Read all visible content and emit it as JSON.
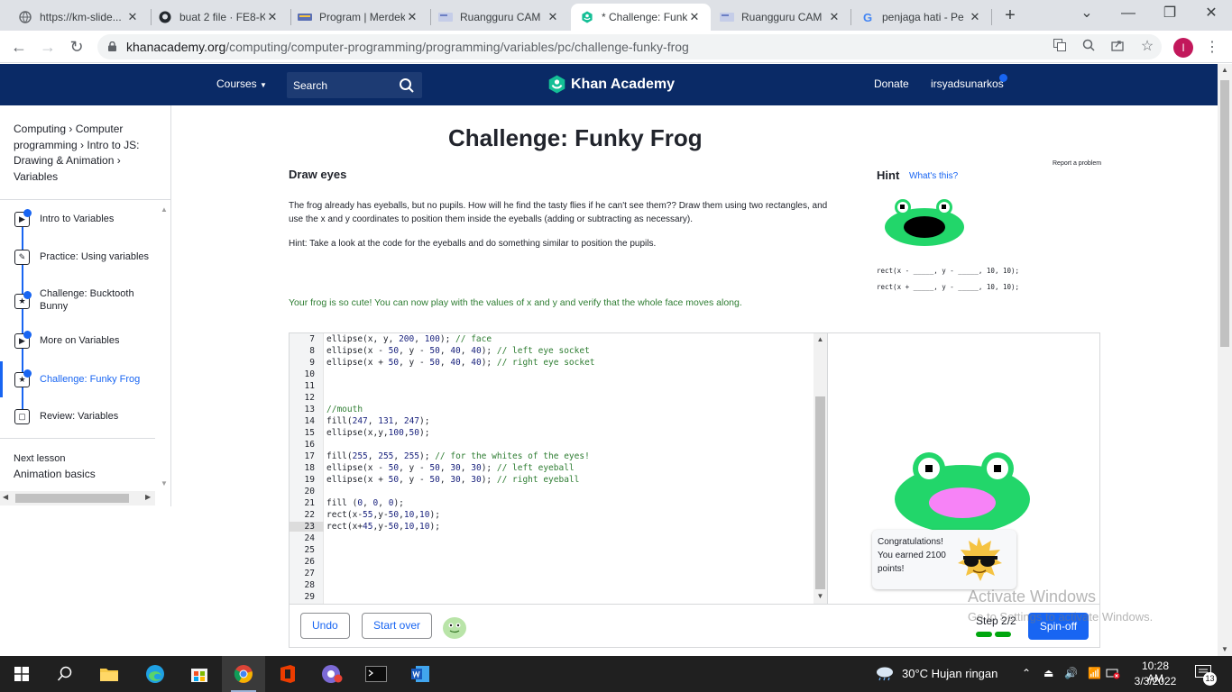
{
  "browser": {
    "tabs": [
      {
        "title": "https://km-slide...",
        "icon": "globe-icon"
      },
      {
        "title": "buat 2 file · FE8-K",
        "icon": "github-icon"
      },
      {
        "title": "Program | Merdek",
        "icon": "kemdikbud-icon"
      },
      {
        "title": "Ruangguru CAM",
        "icon": "ruangguru-icon"
      },
      {
        "title": "* Challenge: Funk",
        "icon": "khan-academy-icon",
        "active": true
      },
      {
        "title": "Ruangguru CAM",
        "icon": "ruangguru-icon"
      },
      {
        "title": "penjaga hati - Pe",
        "icon": "google-icon"
      }
    ],
    "url_domain": "khanacademy.org",
    "url_path": "/computing/computer-programming/programming/variables/pc/challenge-funky-frog",
    "profile_initial": "I"
  },
  "header": {
    "courses_label": "Courses",
    "search_placeholder": "Search",
    "logo_text": "Khan Academy",
    "donate_label": "Donate",
    "username": "irsyadsunarkos",
    "bg_color": "#0a2a66"
  },
  "sidebar": {
    "breadcrumb": [
      {
        "label": "Computing"
      },
      {
        "label": "Computer programming"
      },
      {
        "label": "Intro to JS: Drawing & Animation"
      },
      {
        "label": "Variables"
      }
    ],
    "items": [
      {
        "label": "Intro to Variables",
        "icon": "video-icon",
        "completed": true
      },
      {
        "label": "Practice: Using variables",
        "icon": "pencil-icon",
        "completed": false
      },
      {
        "label": "Challenge: Bucktooth Bunny",
        "icon": "star-icon",
        "completed": true
      },
      {
        "label": "More on Variables",
        "icon": "video-icon",
        "completed": true
      },
      {
        "label": "Challenge: Funky Frog",
        "icon": "star-icon",
        "completed": true,
        "active": true
      },
      {
        "label": "Review: Variables",
        "icon": "article-icon",
        "completed": false
      }
    ],
    "next_lesson_label": "Next lesson",
    "next_lesson_title": "Animation basics"
  },
  "main": {
    "title": "Challenge: Funky Frog",
    "step_title": "Draw eyes",
    "report_problem": "Report a problem",
    "instructions": "The frog already has eyeballs, but no pupils. How will he find the tasty flies if he can't see them?? Draw them using two rectangles, and use the x and y coordinates to position them inside the eyeballs (adding or subtracting as necessary).",
    "hint_text": "Hint: Take a look at the code for the eyeballs and do something similar to position the pupils.",
    "success_message": "Your frog is so cute! You can now play with the values of x and y and verify that the whole face moves along.",
    "hint_heading": "Hint",
    "whats_this": "What's this?",
    "hint_code": [
      "rect(x - _____, y - _____, 10, 10);",
      "rect(x + _____, y - _____, 10, 10);"
    ]
  },
  "editor": {
    "lines": [
      {
        "n": "7",
        "code": "ellipse(x, y, 200, 100); // face"
      },
      {
        "n": "8",
        "code": "ellipse(x - 50, y - 50, 40, 40); // left eye socket"
      },
      {
        "n": "9",
        "code": "ellipse(x + 50, y - 50, 40, 40); // right eye socket"
      },
      {
        "n": "10",
        "code": ""
      },
      {
        "n": "11",
        "code": ""
      },
      {
        "n": "12",
        "code": ""
      },
      {
        "n": "13",
        "code": "//mouth"
      },
      {
        "n": "14",
        "code": "fill(247, 131, 247);"
      },
      {
        "n": "15",
        "code": "ellipse(x,y,100,50);"
      },
      {
        "n": "16",
        "code": ""
      },
      {
        "n": "17",
        "code": "fill(255, 255, 255); // for the whites of the eyes!"
      },
      {
        "n": "18",
        "code": "ellipse(x - 50, y - 50, 30, 30); // left eyeball"
      },
      {
        "n": "19",
        "code": "ellipse(x + 50, y - 50, 30, 30); // right eyeball"
      },
      {
        "n": "20",
        "code": ""
      },
      {
        "n": "21",
        "code": "fill (0, 0, 0);"
      },
      {
        "n": "22",
        "code": "rect(x-55,y-50,10,10);"
      },
      {
        "n": "23",
        "code": "rect(x+45,y-50,10,10);",
        "active": true
      },
      {
        "n": "24",
        "code": ""
      },
      {
        "n": "25",
        "code": ""
      },
      {
        "n": "26",
        "code": ""
      },
      {
        "n": "27",
        "code": ""
      },
      {
        "n": "28",
        "code": ""
      },
      {
        "n": "29",
        "code": ""
      }
    ],
    "undo_label": "Undo",
    "start_over_label": "Start over",
    "step_label": "Step 2/2",
    "steps_completed": 2,
    "steps_total": 2,
    "spinoff_label": "Spin-off"
  },
  "toast": {
    "text": "Congratulations! You earned 2100 points!"
  },
  "watermark": {
    "title": "Activate Windows",
    "subtitle": "Go to Settings to activate Windows."
  },
  "taskbar": {
    "weather": "30°C  Hujan ringan",
    "time": "10:28 AM",
    "date": "3/3/2022",
    "notification_count": "13"
  }
}
